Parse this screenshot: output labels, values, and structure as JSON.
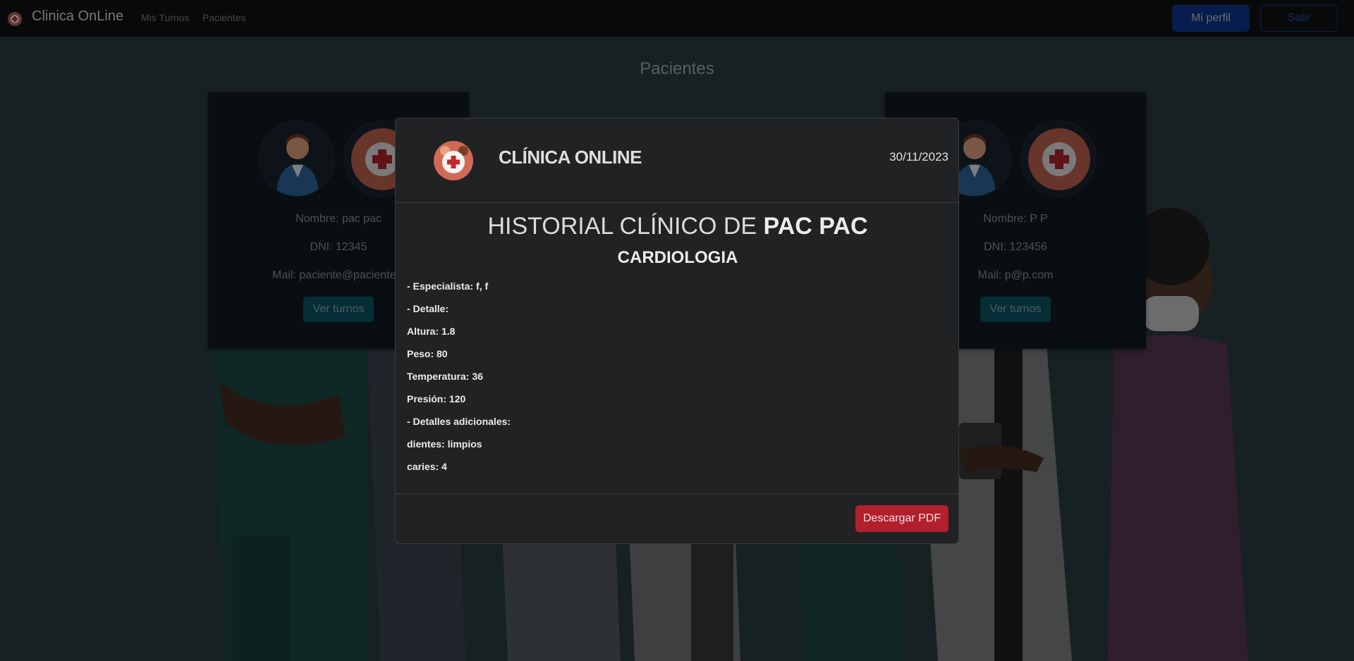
{
  "navbar": {
    "brand": "Clinica OnLine",
    "links": [
      "Mis Turnos",
      "Pacientes"
    ],
    "profile_button": "Mi perfil",
    "logout_button": "Salir"
  },
  "page": {
    "title": "Pacientes"
  },
  "patients": [
    {
      "name": "Nombre: pac pac",
      "dni": "DNI: 12345",
      "mail": "Mail: paciente@paciente.c",
      "button": "Ver turnos"
    },
    {
      "name": "Nombre: P P",
      "dni": "DNI: 123456",
      "mail": "Mail: p@p.com",
      "button": "Ver turnos"
    }
  ],
  "modal": {
    "brand": "CLÍNICA ONLINE",
    "date": "30/11/2023",
    "title_prefix": "HISTORIAL CLÍNICO DE ",
    "title_name": "PAC PAC",
    "specialty": "CARDIOLOGIA",
    "details": [
      "- Especialista: f, f",
      "- Detalle:",
      "Altura: 1.8",
      "Peso: 80",
      "Temperatura: 36",
      "Presión: 120",
      "- Detalles adicionales:",
      "dientes: limpios",
      "caries: 4"
    ],
    "download_button": "Descargar PDF"
  },
  "colors": {
    "primary": "#0d3a9a",
    "info": "#0b5d6e",
    "danger": "#b21f2d",
    "modal_bg": "#212223",
    "navbar_bg": "#101314"
  },
  "icons": [
    "clinic-logo-icon",
    "patient-avatar-icon",
    "medical-avatar-icon"
  ]
}
